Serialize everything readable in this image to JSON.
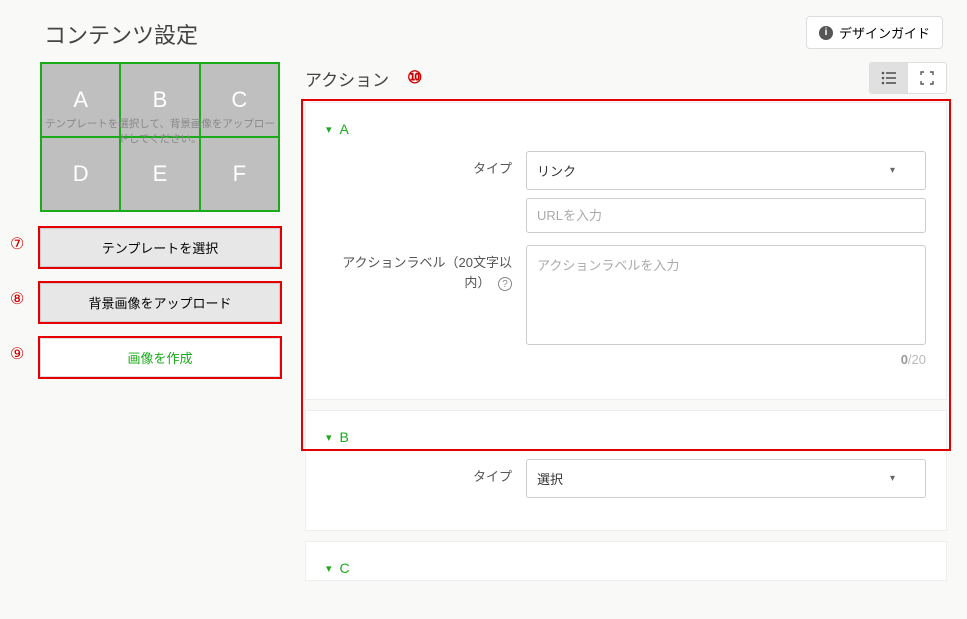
{
  "page_title": "コンテンツ設定",
  "design_guide_label": "デザインガイド",
  "grid": {
    "cells": [
      "A",
      "B",
      "C",
      "D",
      "E",
      "F"
    ],
    "caption": "テンプレートを選択して、背景画像をアップロードしてください。"
  },
  "side_buttons": {
    "select_template": "テンプレートを選択",
    "upload_bg": "背景画像をアップロード",
    "create_image": "画像を作成"
  },
  "annotations": {
    "n7": "⑦",
    "n8": "⑧",
    "n9": "⑨",
    "n10": "⑩"
  },
  "right": {
    "section_title": "アクション",
    "panels": [
      {
        "key": "A",
        "type_label": "タイプ",
        "type_value": "リンク",
        "url_placeholder": "URLを入力",
        "action_label_label": "アクションラベル（20文字以内）",
        "action_label_placeholder": "アクションラベルを入力",
        "char_count": "0",
        "char_max": "/20"
      },
      {
        "key": "B",
        "type_label": "タイプ",
        "type_value": "選択"
      },
      {
        "key": "C"
      }
    ]
  }
}
